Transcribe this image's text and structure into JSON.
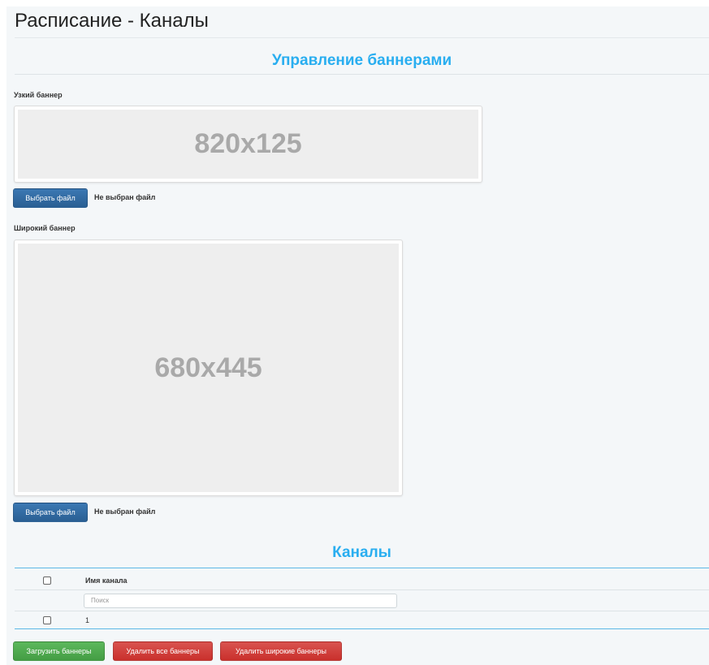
{
  "page": {
    "title": "Расписание - Каналы"
  },
  "banners": {
    "section_title": "Управление баннерами",
    "narrow": {
      "label": "Узкий баннер",
      "placeholder": "820x125",
      "choose_label": "Выбрать файл",
      "file_status": "Не выбран файл"
    },
    "wide": {
      "label": "Широкий баннер",
      "placeholder": "680x445",
      "choose_label": "Выбрать файл",
      "file_status": "Не выбран файл"
    }
  },
  "channels": {
    "section_title": "Каналы",
    "header": {
      "name": "Имя канала"
    },
    "search_placeholder": "Поиск",
    "rows": [
      {
        "name": "1",
        "checked": false
      }
    ]
  },
  "actions": {
    "upload_label": "Загрузить баннеры",
    "delete_all_label": "Удалить все баннеры",
    "delete_wide_label": "Удалить широкие баннеры"
  },
  "colors": {
    "accent": "#29aef0",
    "primary_button": "#2a5f93",
    "success_button": "#449d44",
    "danger_button": "#c9302c"
  }
}
